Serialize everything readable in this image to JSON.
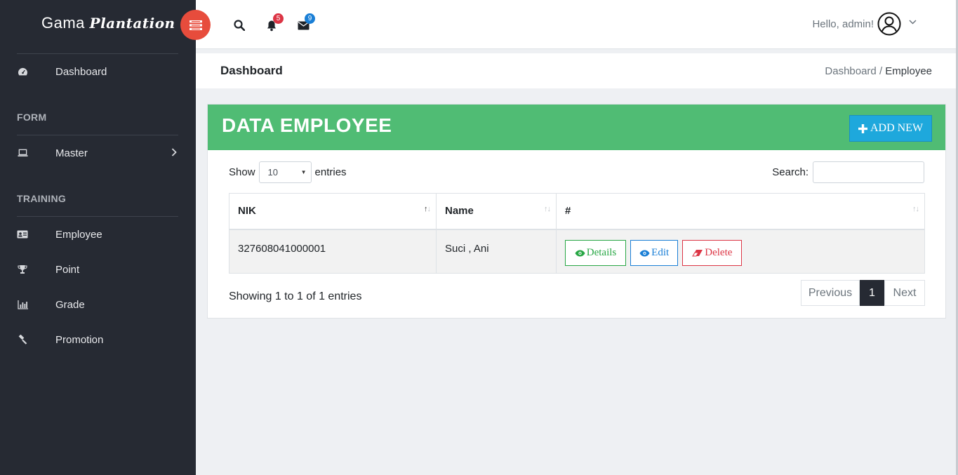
{
  "brand": {
    "part1": "Gama",
    "part2": "Plantation"
  },
  "sidebar": {
    "dashboard": {
      "label": "Dashboard",
      "icon": "dashboard-icon"
    },
    "section_form": "FORM",
    "master": {
      "label": "Master",
      "icon": "laptop-icon"
    },
    "section_training": "TRAINING",
    "items": [
      {
        "label": "Employee",
        "icon": "id-card-icon"
      },
      {
        "label": "Point",
        "icon": "trophy-icon"
      },
      {
        "label": "Grade",
        "icon": "bar-chart-icon"
      },
      {
        "label": "Promotion",
        "icon": "gavel-icon"
      }
    ]
  },
  "topbar": {
    "notifications_count": "5",
    "messages_count": "9",
    "greeting": "Hello, admin!"
  },
  "page": {
    "title": "Dashboard",
    "breadcrumb": {
      "parent": "Dashboard",
      "separator": "/",
      "current": "Employee"
    }
  },
  "card": {
    "title": "DATA EMPLOYEE",
    "add_label": "ADD NEW",
    "show_label": "Show",
    "entries_label": "entries",
    "page_length": "10",
    "search_label": "Search:",
    "search_value": ""
  },
  "table": {
    "columns": [
      "NIK",
      "Name",
      "#"
    ],
    "rows": [
      {
        "nik": "327608041000001",
        "name": "Suci , Ani"
      }
    ],
    "actions": {
      "details": "Details",
      "edit": "Edit",
      "delete": "Delete"
    }
  },
  "footer": {
    "info": "Showing 1 to 1 of 1 entries",
    "previous": "Previous",
    "page": "1",
    "next": "Next"
  },
  "colors": {
    "sidebar": "#262a33",
    "header_green": "#50bc74",
    "add_button": "#1ea8dc",
    "toggle_red": "#e74c3c",
    "badge_red": "#dc3545",
    "badge_blue": "#1a7fd6"
  }
}
